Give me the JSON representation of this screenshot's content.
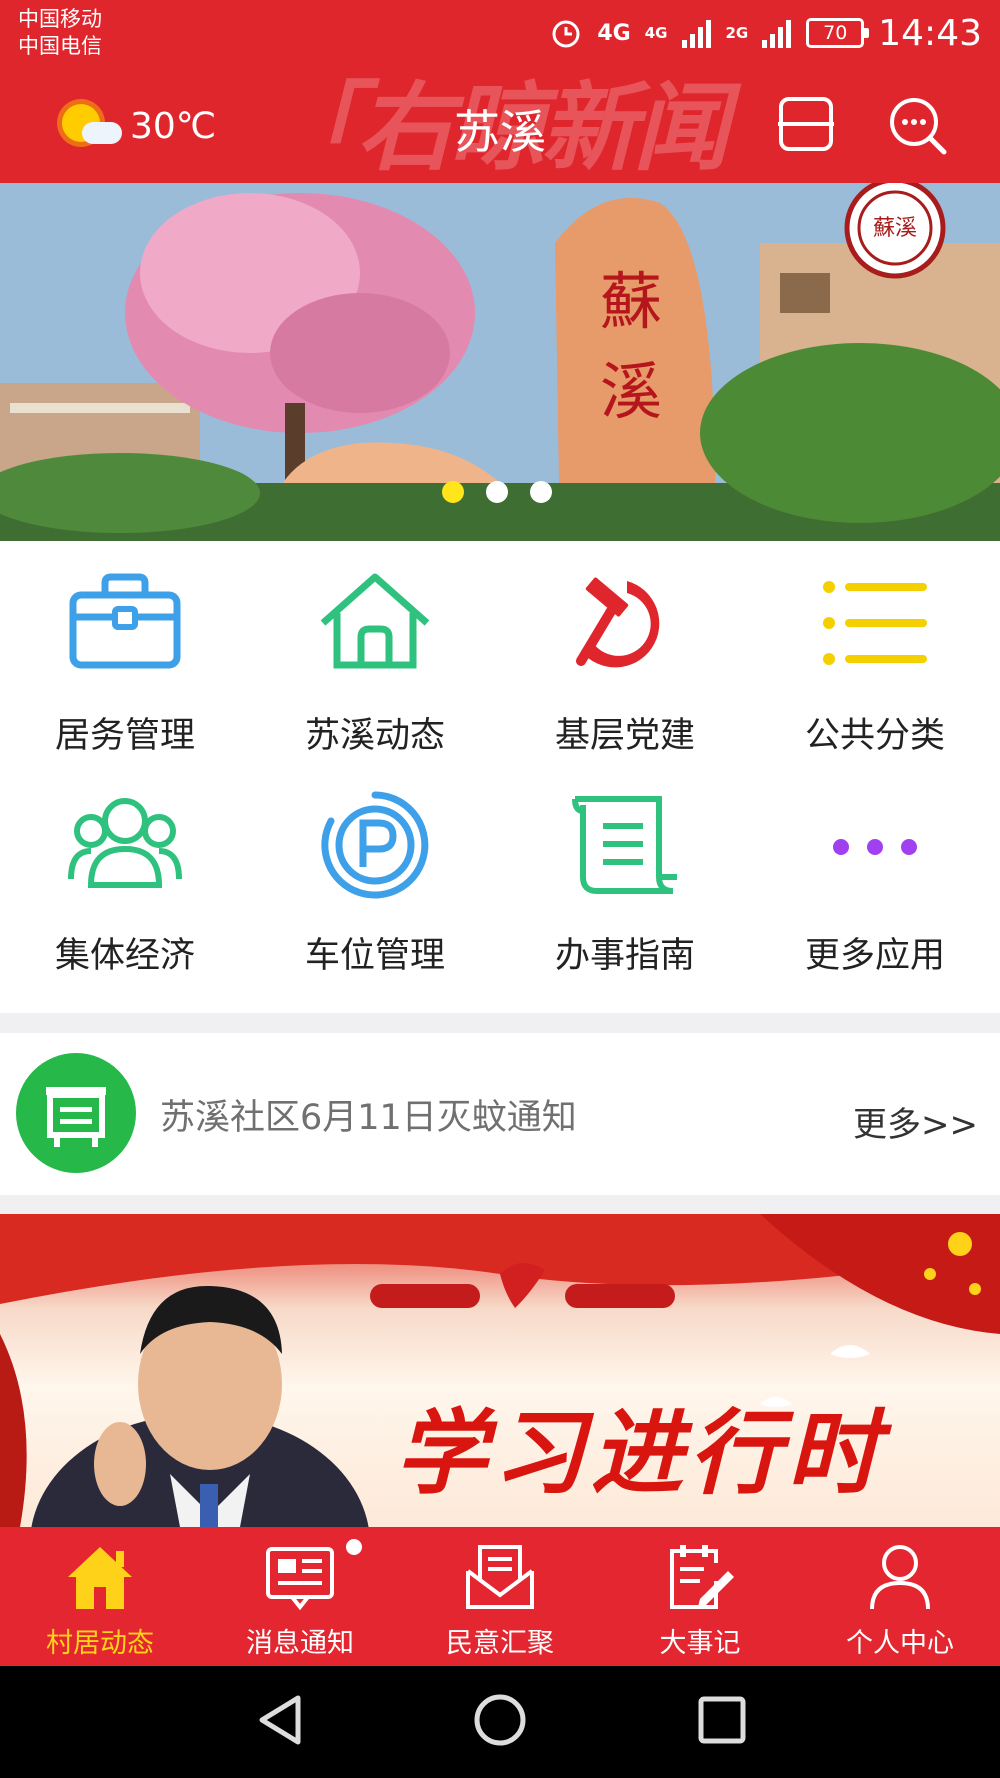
{
  "status_bar": {
    "carrier1": "中国移动",
    "carrier2": "中国电信",
    "net1": "4G",
    "net2": "4G",
    "net3": "2G",
    "battery": "70",
    "time": "14:43"
  },
  "header": {
    "temperature": "30℃",
    "title": "苏溪",
    "watermark": "「右晾新闻"
  },
  "banner": {
    "slides_total": 3,
    "active_slide": 1
  },
  "grid": {
    "items": [
      {
        "label": "居务管理",
        "icon": "briefcase-icon"
      },
      {
        "label": "苏溪动态",
        "icon": "home-icon"
      },
      {
        "label": "基层党建",
        "icon": "hammer-sickle-icon"
      },
      {
        "label": "公共分类",
        "icon": "list-icon"
      },
      {
        "label": "集体经济",
        "icon": "group-icon"
      },
      {
        "label": "车位管理",
        "icon": "parking-icon"
      },
      {
        "label": "办事指南",
        "icon": "scroll-icon"
      },
      {
        "label": "更多应用",
        "icon": "more-dots-icon"
      }
    ]
  },
  "notice": {
    "text": "苏溪社区6月11日灭蚊通知",
    "more": "更多>>"
  },
  "promo": {
    "title": "学习进行时"
  },
  "tabbar": {
    "items": [
      {
        "label": "村居动态",
        "icon": "home-icon"
      },
      {
        "label": "消息通知",
        "icon": "news-icon"
      },
      {
        "label": "民意汇聚",
        "icon": "mail-icon"
      },
      {
        "label": "大事记",
        "icon": "note-edit-icon"
      },
      {
        "label": "个人中心",
        "icon": "user-icon"
      }
    ]
  },
  "colors": {
    "brand_red": "#e0262d",
    "active_tab": "#ffd21a",
    "notice_green": "#27b84a"
  }
}
